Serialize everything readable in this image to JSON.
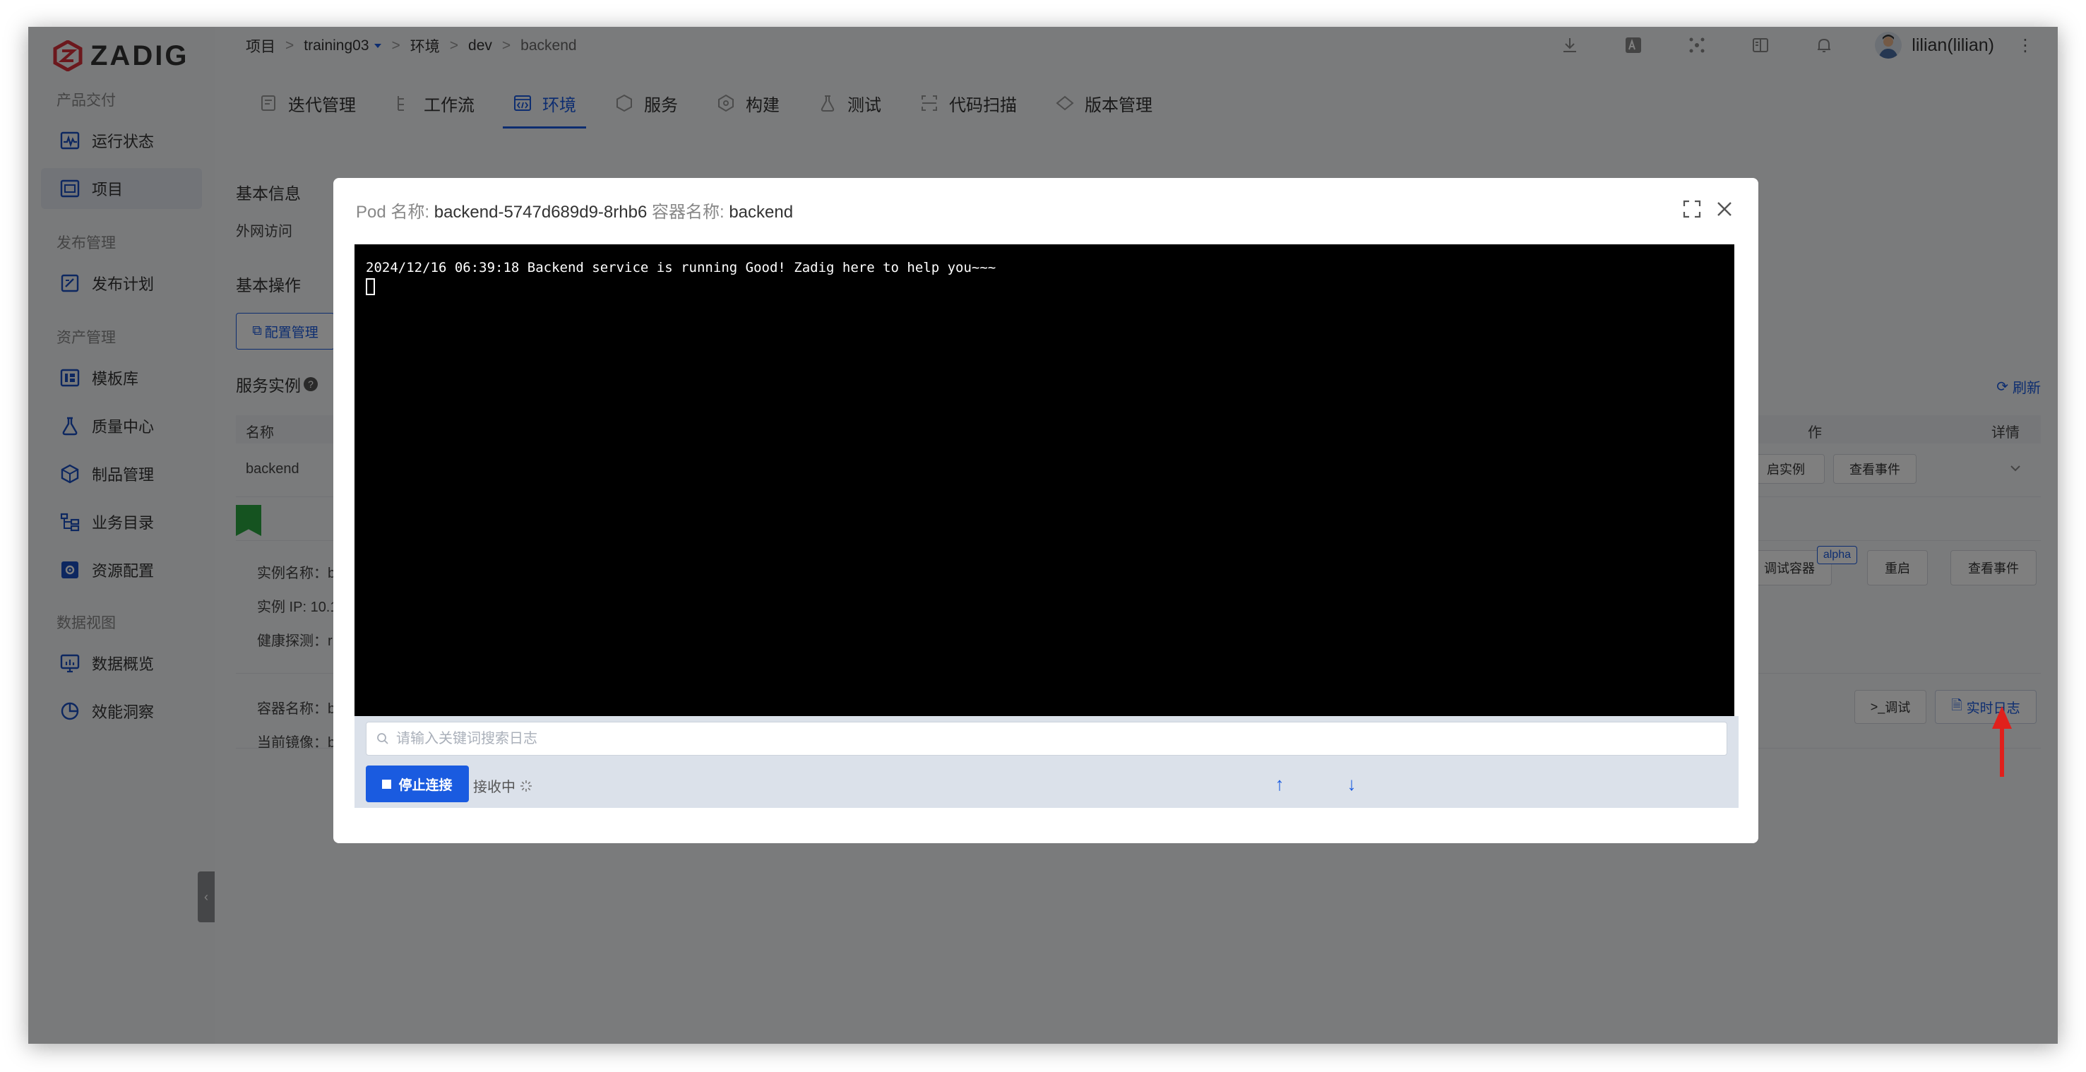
{
  "app": {
    "logo_text": "ZADIG"
  },
  "sidebar": {
    "sections": [
      {
        "label": "产品交付",
        "items": [
          "运行状态",
          "项目"
        ]
      },
      {
        "label": "发布管理",
        "items": [
          "发布计划"
        ]
      },
      {
        "label": "资产管理",
        "items": [
          "模板库",
          "质量中心",
          "制品管理",
          "业务目录",
          "资源配置"
        ]
      },
      {
        "label": "数据视图",
        "items": [
          "数据概览",
          "效能洞察"
        ]
      }
    ],
    "active_item": "项目",
    "collapse_glyph": "‹"
  },
  "breadcrumb": [
    "项目",
    "training03",
    "环境",
    "dev",
    "backend"
  ],
  "breadcrumb_sep": ">",
  "user": {
    "name": "lilian(lilian)"
  },
  "more_glyph": "⋮",
  "tabs": [
    "迭代管理",
    "工作流",
    "环境",
    "服务",
    "构建",
    "测试",
    "代码扫描",
    "版本管理"
  ],
  "active_tab": "环境",
  "background": {
    "basic_info": "基本信息",
    "external_access": "外网访问",
    "basic_ops": "基本操作",
    "config_mgmt": "配置管理",
    "service_instances": "服务实例",
    "help_glyph": "?",
    "refresh": "刷新",
    "col_name": "名称",
    "col_detail": "详情",
    "col_partial": "作",
    "service_name": "backend",
    "restart_instance": "启实例",
    "view_events": "查看事件",
    "instance_name_label": "实例名称：b",
    "instance_ip_label": "实例 IP: 10.1",
    "health_probe_label": "健康探测：r",
    "debug_container": "调试容器",
    "alpha_badge": "alpha",
    "restart": "重启",
    "view_events_2": "查看事件",
    "container_name_label": "容器名称：b",
    "current_image_label": "当前镜像：b",
    "debug": "调试",
    "realtime_log": "实时日志"
  },
  "modal": {
    "pod_label": "Pod 名称:",
    "pod_name": "backend-5747d689d9-8rhb6",
    "container_label": "容器名称:",
    "container_name": "backend",
    "log_line": "2024/12/16 06:39:18 Backend service is running Good! Zadig here to help you~~~",
    "search_placeholder": "请输入关键词搜索日志",
    "stop_label": "停止连接",
    "receiving_label": "接收中",
    "arrow_up": "↑",
    "arrow_down": "↓"
  },
  "colors": {
    "primary": "#1a5be0",
    "terminal_bg": "#000000",
    "panel_bg": "#dbe1ea",
    "annotation_red": "#e0201c",
    "logo_red": "#d8313a"
  }
}
